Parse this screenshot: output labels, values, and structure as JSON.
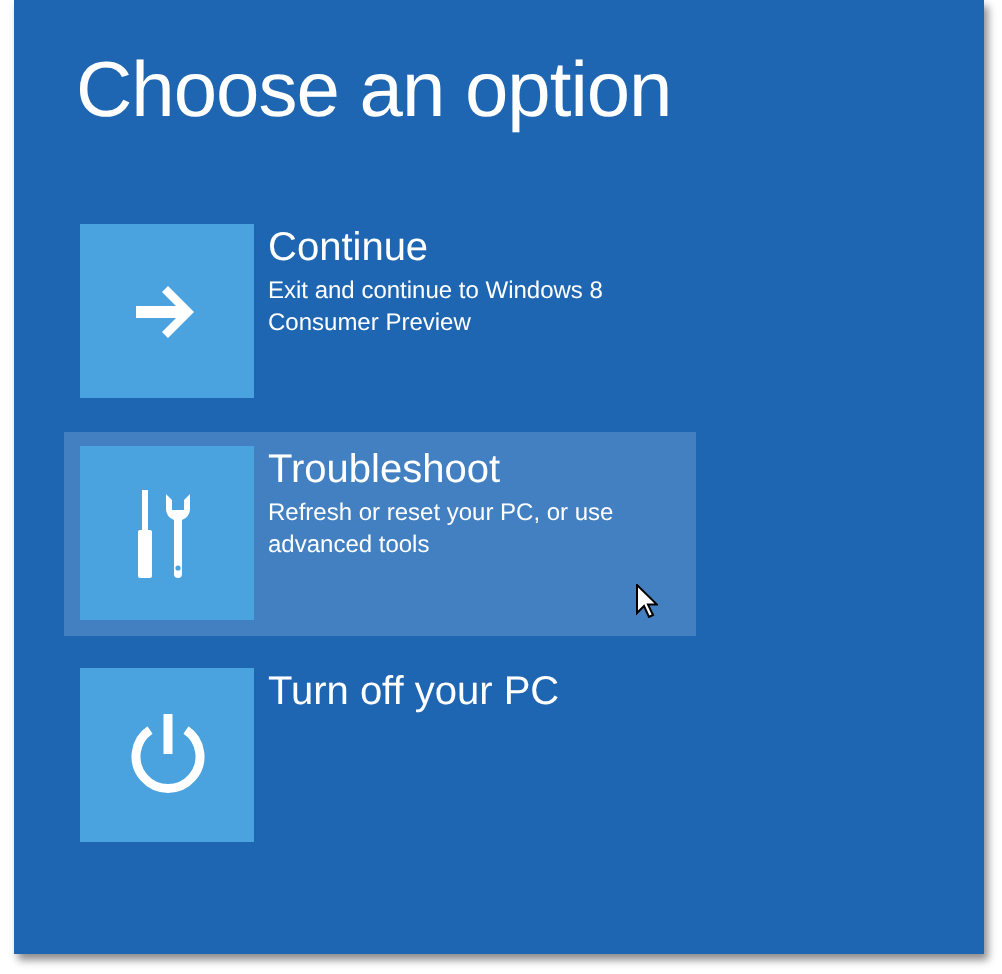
{
  "title": "Choose an option",
  "options": [
    {
      "title": "Continue",
      "description": "Exit and continue to Windows 8 Consumer Preview",
      "selected": false
    },
    {
      "title": "Troubleshoot",
      "description": "Refresh or reset your PC, or use advanced tools",
      "selected": true
    },
    {
      "title": "Turn off your PC",
      "selected": false
    }
  ]
}
